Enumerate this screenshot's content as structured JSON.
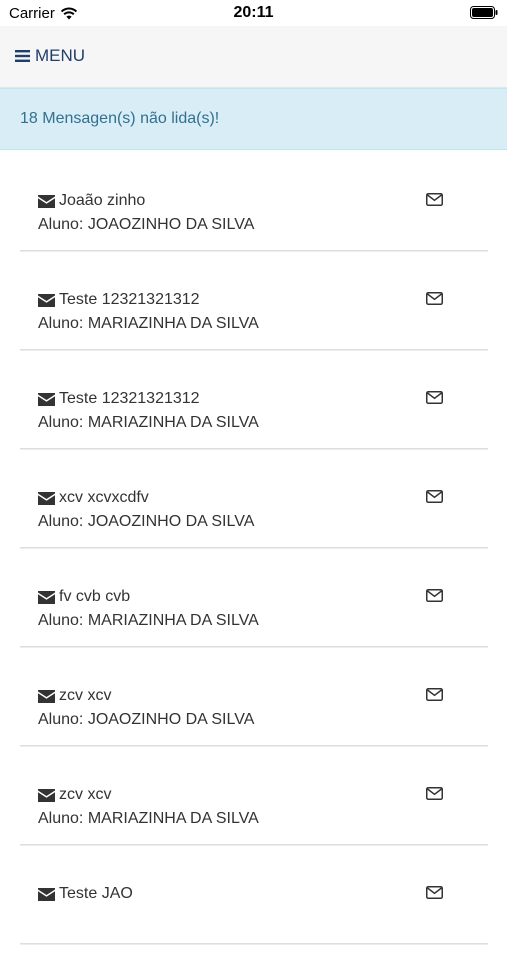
{
  "status_bar": {
    "carrier": "Carrier",
    "time": "20:11"
  },
  "nav": {
    "menu_label": "MENU",
    "menu_icon": "hamburger-icon"
  },
  "alert": {
    "text": "18 Mensagen(s) não lida(s)!"
  },
  "colors": {
    "nav_text": "#1f3f6b",
    "alert_bg": "#d9edf7",
    "alert_text": "#31708f",
    "body_text": "#333333"
  },
  "messages": [
    {
      "subject": "Joaão zinho",
      "student": "Aluno: JOAOZINHO DA SILVA"
    },
    {
      "subject": "Teste 12321321312",
      "student": "Aluno: MARIAZINHA DA SILVA"
    },
    {
      "subject": "Teste 12321321312",
      "student": "Aluno: MARIAZINHA DA SILVA"
    },
    {
      "subject": "xcv xcvxcdfv",
      "student": "Aluno: JOAOZINHO DA SILVA"
    },
    {
      "subject": "fv cvb cvb",
      "student": "Aluno: MARIAZINHA DA SILVA"
    },
    {
      "subject": "zcv xcv",
      "student": "Aluno: JOAOZINHO DA SILVA"
    },
    {
      "subject": "zcv xcv",
      "student": "Aluno: MARIAZINHA DA SILVA"
    },
    {
      "subject": "Teste JAO",
      "student": ""
    }
  ]
}
